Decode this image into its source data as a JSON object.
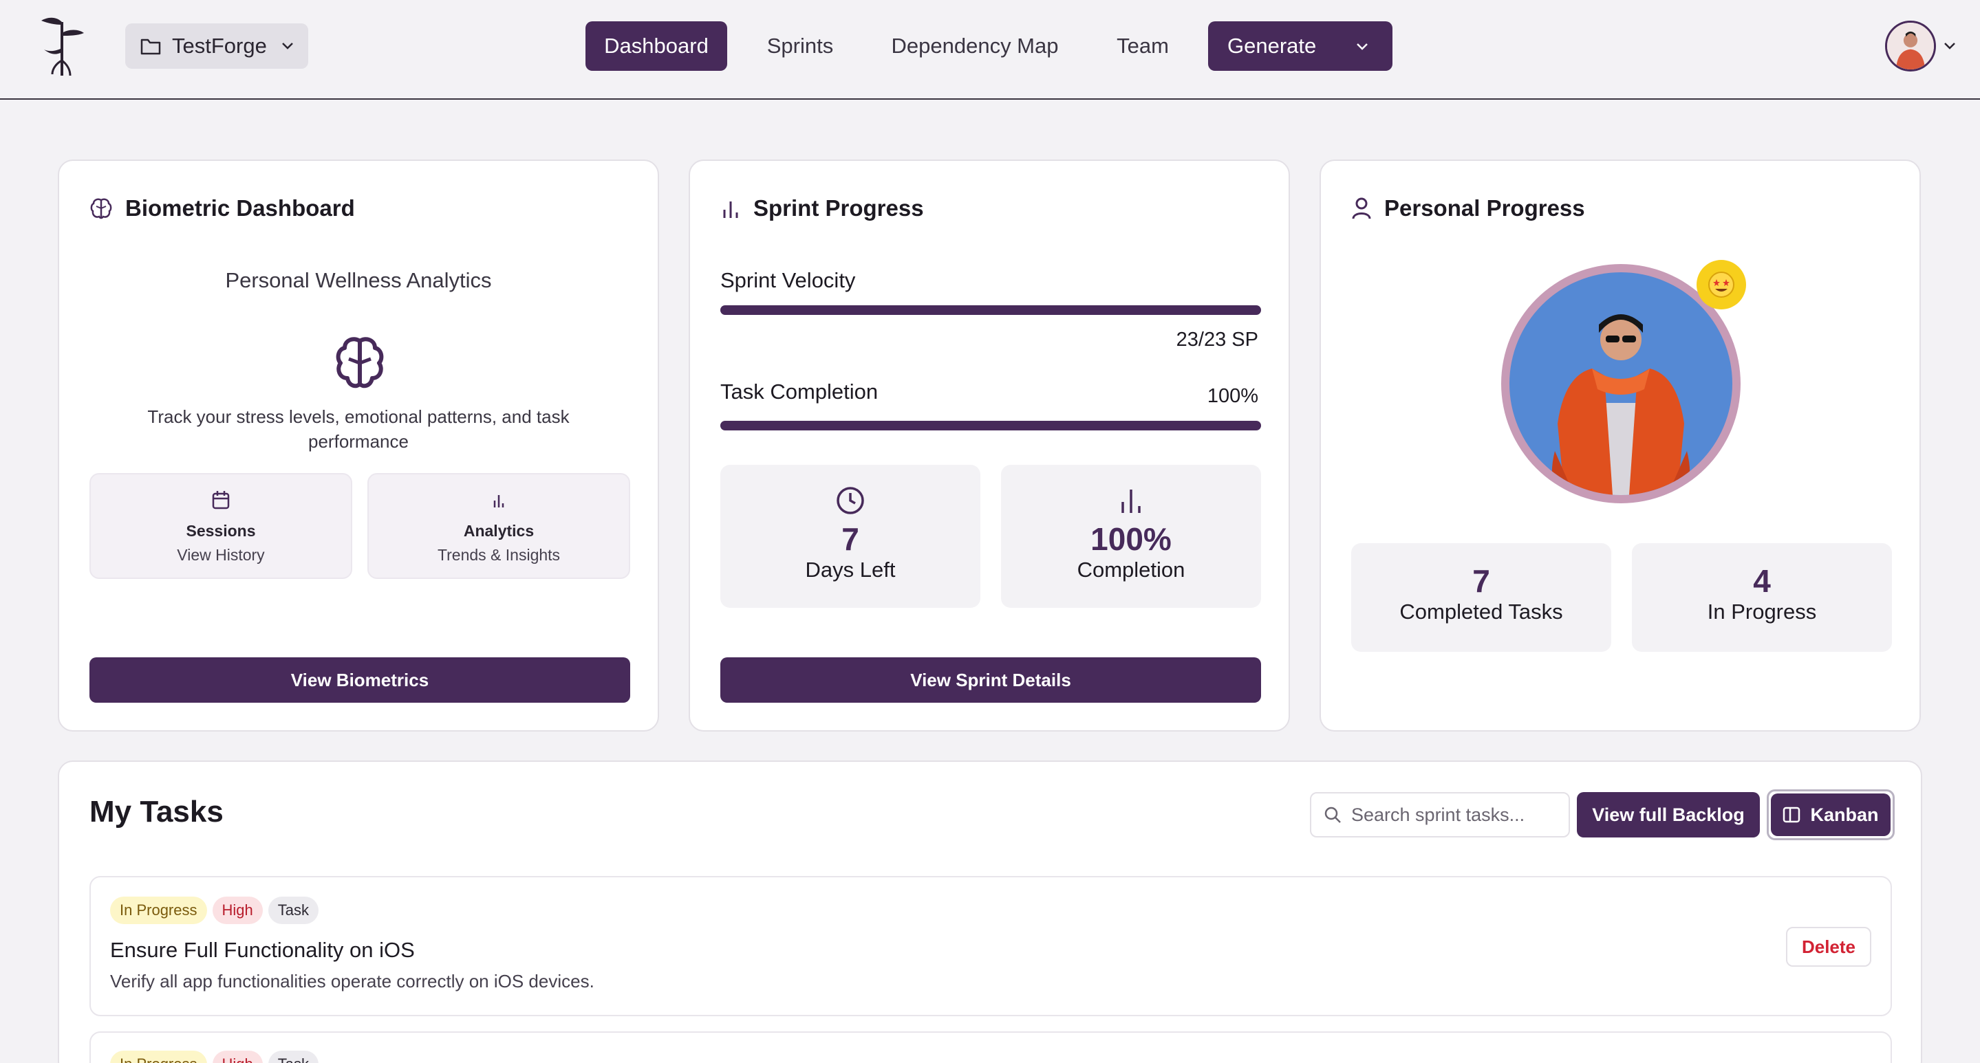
{
  "header": {
    "project_label": "TestForge",
    "nav": [
      "Dashboard",
      "Sprints",
      "Dependency Map",
      "Team"
    ],
    "generate_label": "Generate"
  },
  "biometric": {
    "title": "Biometric Dashboard",
    "subtitle": "Personal Wellness Analytics",
    "description": "Track your stress levels, emotional patterns, and task performance",
    "tiles": [
      {
        "title": "Sessions",
        "subtitle": "View History",
        "icon": "calendar-icon"
      },
      {
        "title": "Analytics",
        "subtitle": "Trends & Insights",
        "icon": "bar-chart-icon"
      }
    ],
    "button": "View Biometrics"
  },
  "sprint": {
    "title": "Sprint Progress",
    "velocity_label": "Sprint Velocity",
    "velocity_value": "23/23 SP",
    "velocity_fraction": 1.0,
    "completion_label": "Task Completion",
    "completion_value": "100%",
    "completion_fraction": 1.0,
    "days_left_value": "7",
    "days_left_label": "Days Left",
    "completion_stat_value": "100%",
    "completion_stat_label": "Completion",
    "button": "View Sprint Details"
  },
  "personal": {
    "title": "Personal Progress",
    "completed_value": "7",
    "completed_label": "Completed Tasks",
    "in_progress_value": "4",
    "in_progress_label": "In Progress"
  },
  "tasks": {
    "title": "My Tasks",
    "search_placeholder": "Search sprint tasks...",
    "backlog_button": "View full Backlog",
    "kanban_button": "Kanban",
    "items": [
      {
        "status": "In Progress",
        "priority": "High",
        "type": "Task",
        "title": "Ensure Full Functionality on iOS",
        "description": "Verify all app functionalities operate correctly on iOS devices.",
        "delete_label": "Delete"
      },
      {
        "status": "In Progress",
        "priority": "High",
        "type": "Task"
      }
    ]
  },
  "colors": {
    "accent": "#472a5a",
    "background": "#f3f2f5",
    "danger": "#d22233"
  }
}
